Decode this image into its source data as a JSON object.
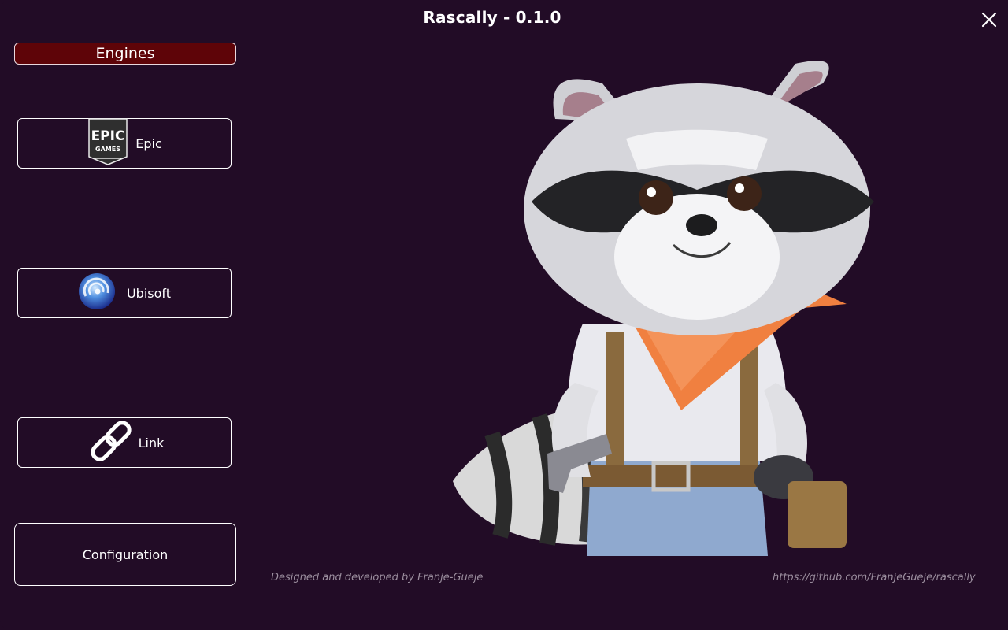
{
  "window": {
    "title": "Rascally - 0.1.0"
  },
  "sidebar": {
    "header": "Engines",
    "engines": [
      {
        "label": "Epic",
        "icon": "epic-games-logo",
        "logo_text": [
          "EPIC",
          "GAMES"
        ]
      },
      {
        "label": "Ubisoft",
        "icon": "ubisoft-logo"
      },
      {
        "label": "Link",
        "icon": "link-chain-icon"
      }
    ],
    "configuration_label": "Configuration"
  },
  "footer": {
    "credit": "Designed and developed by Franje-Gueje",
    "repo_url": "https://github.com/FranjeGueje/rascally"
  },
  "colors": {
    "background": "#220c26",
    "engines_header": "#5e0408",
    "footer_text": "#9c8f9f",
    "button_border": "#ffffff"
  }
}
